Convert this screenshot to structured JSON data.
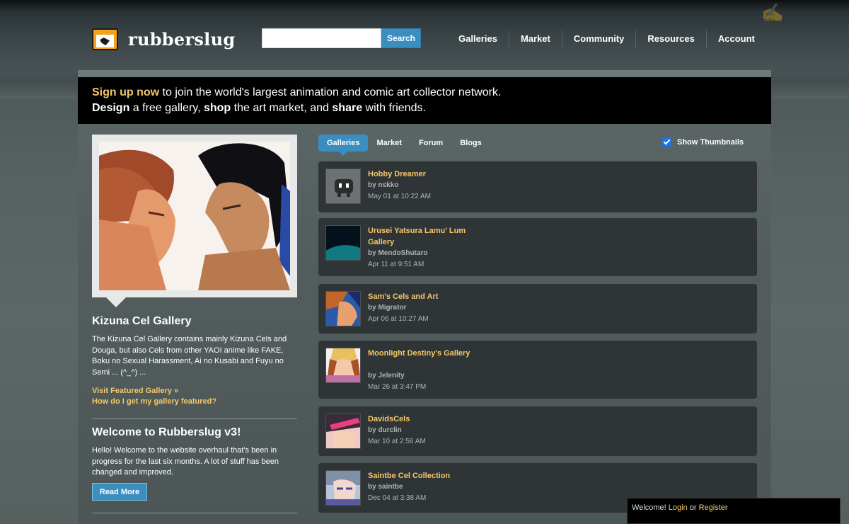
{
  "header": {
    "logo_text": "rubberslug",
    "search_button": "Search",
    "search_value": "",
    "nav": [
      "Galleries",
      "Market",
      "Community",
      "Resources",
      "Account"
    ]
  },
  "banner": {
    "line1_highlight": "Sign up now",
    "line1_rest": " to join the world's largest animation and comic art collector network.",
    "line2_w1": "Design",
    "line2_t1": " a free gallery, ",
    "line2_w2": "shop",
    "line2_t2": " the art market, and ",
    "line2_w3": "share",
    "line2_t3": " with friends."
  },
  "featured": {
    "title": "Kizuna Cel Gallery",
    "description": "The Kizuna Cel Gallery contains mainly Kizuna Cels and Douga, but also Cels from other YAOI anime like FAKE, Boku no Sexual Harassment, Ai no Kusabi and Fuyu no Semi ... (^_^) ...",
    "visit_link": "Visit Featured Gallery »",
    "how_link": "How do I get my gallery featured?"
  },
  "welcome": {
    "title": "Welcome to Rubberslug v3!",
    "text": "Hello! Welcome to the website overhaul that's been in progress for the last six months. A lot of stuff has been changed and improved.",
    "read_more": "Read More"
  },
  "tabs": [
    "Galleries",
    "Market",
    "Forum",
    "Blogs"
  ],
  "active_tab": "Galleries",
  "show_thumbnails": {
    "label": "Show Thumbnails",
    "checked": true
  },
  "galleries": [
    {
      "title": "Hobby Dreamer",
      "by": "by nskko",
      "date": "May 01 at 10:22 AM",
      "thumb": "robot-icon"
    },
    {
      "title": "Urusei Yatsura Lamu' Lum Gallery",
      "by": "by MendoShutaro",
      "date": "Apr 11 at 9:51 AM",
      "thumb": "teal-dark"
    },
    {
      "title": "Sam's Cels and Art",
      "by": "by Migrator",
      "date": "Apr 06 at 10:27 AM",
      "thumb": "anime-blue"
    },
    {
      "title": "Moonlight Destiny's Gallery",
      "by": "by Jelenity",
      "date": "Mar 26 at 3:47 PM",
      "thumb": "anime-pastel"
    },
    {
      "title": "DavidsCels",
      "by": "by durclin",
      "date": "Mar 10 at 2:56 AM",
      "thumb": "anime-pink"
    },
    {
      "title": "Saintbe Cel Collection",
      "by": "by saintbe",
      "date": "Dec 04 at 3:38 AM",
      "thumb": "anime-silver"
    }
  ],
  "login_box": {
    "welcome": "Welcome!",
    "login": "Login",
    "or": "or",
    "register": "Register"
  },
  "colors": {
    "accent": "#3a8fc0",
    "link": "#f6c868",
    "card": "#2f3436"
  }
}
